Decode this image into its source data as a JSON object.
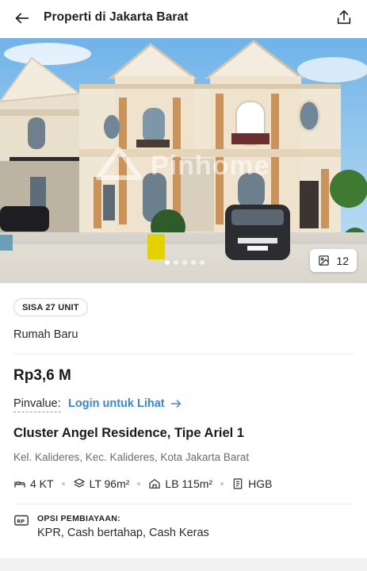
{
  "header": {
    "title": "Properti di Jakarta Barat",
    "back_icon": "arrow-left-icon",
    "share_icon": "share-icon"
  },
  "gallery": {
    "watermark": "Pinhome",
    "photo_count": "12",
    "dots_total": 5,
    "dots_active": 1
  },
  "listing": {
    "badge": "SISA 27 UNIT",
    "property_type": "Rumah Baru",
    "price": "Rp3,6 M",
    "pinvalue_label": "Pinvalue:",
    "pinvalue_link": "Login untuk Lihat",
    "title": "Cluster Angel Residence, Tipe Ariel 1",
    "address": "Kel. Kalideres, Kec. Kalideres, Kota Jakarta Barat",
    "features": {
      "bedrooms": "4 KT",
      "land_area": "LT 96m²",
      "building_area": "LB 115m²",
      "certificate": "HGB"
    },
    "financing_label": "OPSI PEMBIAYAAN:",
    "financing_value": "KPR, Cash bertahap, Cash Keras"
  },
  "colors": {
    "link": "#3a86d6",
    "text": "#1a1a1a",
    "muted": "#6b6b6b"
  }
}
